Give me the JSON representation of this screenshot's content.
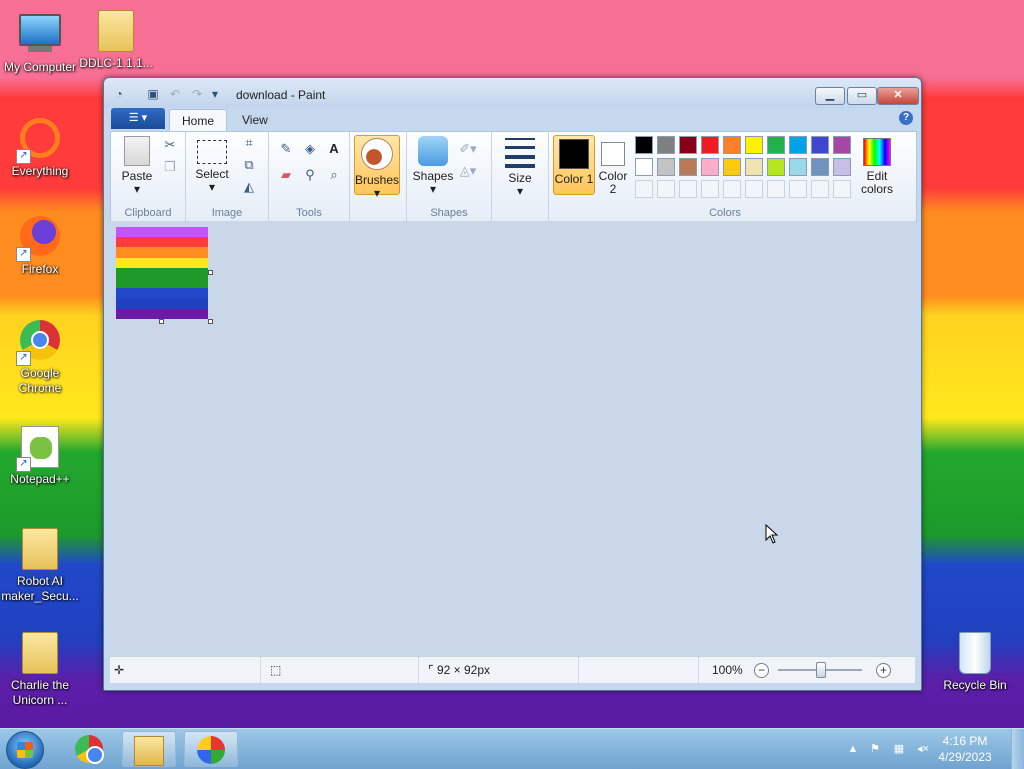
{
  "desktop": {
    "icons": [
      {
        "label": "My Computer",
        "icon": "computer-icon"
      },
      {
        "label": "DDLC-1.1.1...",
        "icon": "folder-icon"
      },
      {
        "label": "Everything",
        "icon": "everything-icon"
      },
      {
        "label": "Firefox",
        "icon": "firefox-icon"
      },
      {
        "label": "Google Chrome",
        "icon": "chrome-icon"
      },
      {
        "label": "Notepad++",
        "icon": "notepadpp-icon"
      },
      {
        "label": "Robot AI maker_Secu...",
        "icon": "folder-icon"
      },
      {
        "label": "Charlie the Unicorn ...",
        "icon": "folder-icon"
      },
      {
        "label": "Recycle Bin",
        "icon": "recycle-bin-icon"
      }
    ]
  },
  "window": {
    "title": "download - Paint",
    "tabs": {
      "file": "☰ ▾",
      "home": "Home",
      "view": "View"
    },
    "ribbon": {
      "clipboard": {
        "label": "Clipboard",
        "paste": "Paste"
      },
      "image": {
        "label": "Image",
        "select": "Select"
      },
      "tools": {
        "label": "Tools"
      },
      "brushes": "Brushes",
      "shapes": {
        "label": "Shapes",
        "button": "Shapes"
      },
      "size": "Size",
      "colors": {
        "label": "Colors",
        "color1": "Color 1",
        "color2": "Color 2",
        "edit": "Edit colors",
        "color1_value": "#000000",
        "color2_value": "#ffffff",
        "palette_row1": [
          "#000000",
          "#7f7f7f",
          "#880015",
          "#ed1c24",
          "#ff7f27",
          "#fff200",
          "#22b14c",
          "#00a2e8",
          "#3f48cc",
          "#a349a4"
        ],
        "palette_row2": [
          "#ffffff",
          "#c3c3c3",
          "#b97a57",
          "#ffaec9",
          "#ffc90e",
          "#efe4b0",
          "#b5e61d",
          "#99d9ea",
          "#7092be",
          "#c8bfe7"
        ]
      }
    },
    "canvas_image_stripes": [
      "#c455ff",
      "#ff3b3b",
      "#ff8c1f",
      "#ffe81c",
      "#1f9a2a",
      "#1f9a2a",
      "#2148c8",
      "#2140c0",
      "#6a1aa6"
    ],
    "status": {
      "image_size": "92 × 92px",
      "zoom": "100%"
    }
  },
  "taskbar": {
    "time": "4:16 PM",
    "date": "4/29/2023"
  }
}
